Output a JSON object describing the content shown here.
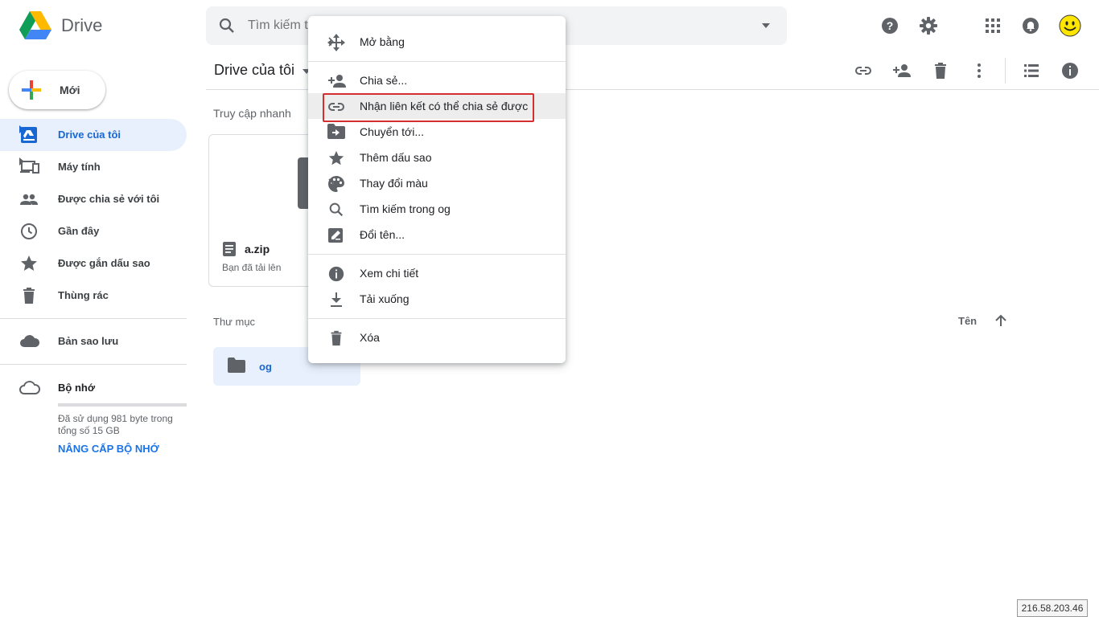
{
  "header": {
    "app_name": "Drive",
    "search_placeholder": "Tìm kiếm trong Drive"
  },
  "sidebar": {
    "new_label": "Mới",
    "items": [
      {
        "label": "Drive của tôi",
        "icon": "drive-icon",
        "active": true
      },
      {
        "label": "Máy tính",
        "icon": "computers-icon"
      },
      {
        "label": "Được chia sẻ với tôi",
        "icon": "people-icon"
      },
      {
        "label": "Gần đây",
        "icon": "clock-icon"
      },
      {
        "label": "Được gắn dấu sao",
        "icon": "star-icon"
      },
      {
        "label": "Thùng rác",
        "icon": "trash-icon"
      }
    ],
    "backup_label": "Bản sao lưu",
    "storage_label": "Bộ nhớ",
    "storage_text": "Đã sử dụng 981 byte trong tổng số 15 GB",
    "upgrade_label": "NÂNG CẤP BỘ NHỚ"
  },
  "main": {
    "title": "Drive của tôi",
    "quick_access_label": "Truy cập nhanh",
    "quick_access_file": {
      "name": "a.zip",
      "subtitle": "Bạn đã tải lên"
    },
    "folders_label": "Thư mục",
    "sort_label": "Tên",
    "folders": [
      {
        "name": "og"
      }
    ]
  },
  "context_menu": {
    "items": [
      {
        "label": "Mở bằng",
        "icon": "open-with-icon",
        "submenu": true
      },
      {
        "label": "Chia sẻ...",
        "icon": "person-add-icon"
      },
      {
        "label": "Nhận liên kết có thể chia sẻ được",
        "icon": "link-icon",
        "highlighted": true
      },
      {
        "label": "Chuyển tới...",
        "icon": "move-to-icon"
      },
      {
        "label": "Thêm dấu sao",
        "icon": "star-icon"
      },
      {
        "label": "Thay đổi màu",
        "icon": "palette-icon",
        "submenu": true
      },
      {
        "label": "Tìm kiếm trong og",
        "icon": "search-icon"
      },
      {
        "label": "Đổi tên...",
        "icon": "rename-icon"
      },
      {
        "label": "Xem chi tiết",
        "icon": "info-icon"
      },
      {
        "label": "Tải xuống",
        "icon": "download-icon"
      },
      {
        "label": "Xóa",
        "icon": "trash-icon"
      }
    ]
  },
  "status": {
    "ip": "216.58.203.46"
  },
  "colors": {
    "accent": "#1a73e8",
    "active_bg": "#e8f0fe",
    "highlight_border": "#d32f2f"
  }
}
